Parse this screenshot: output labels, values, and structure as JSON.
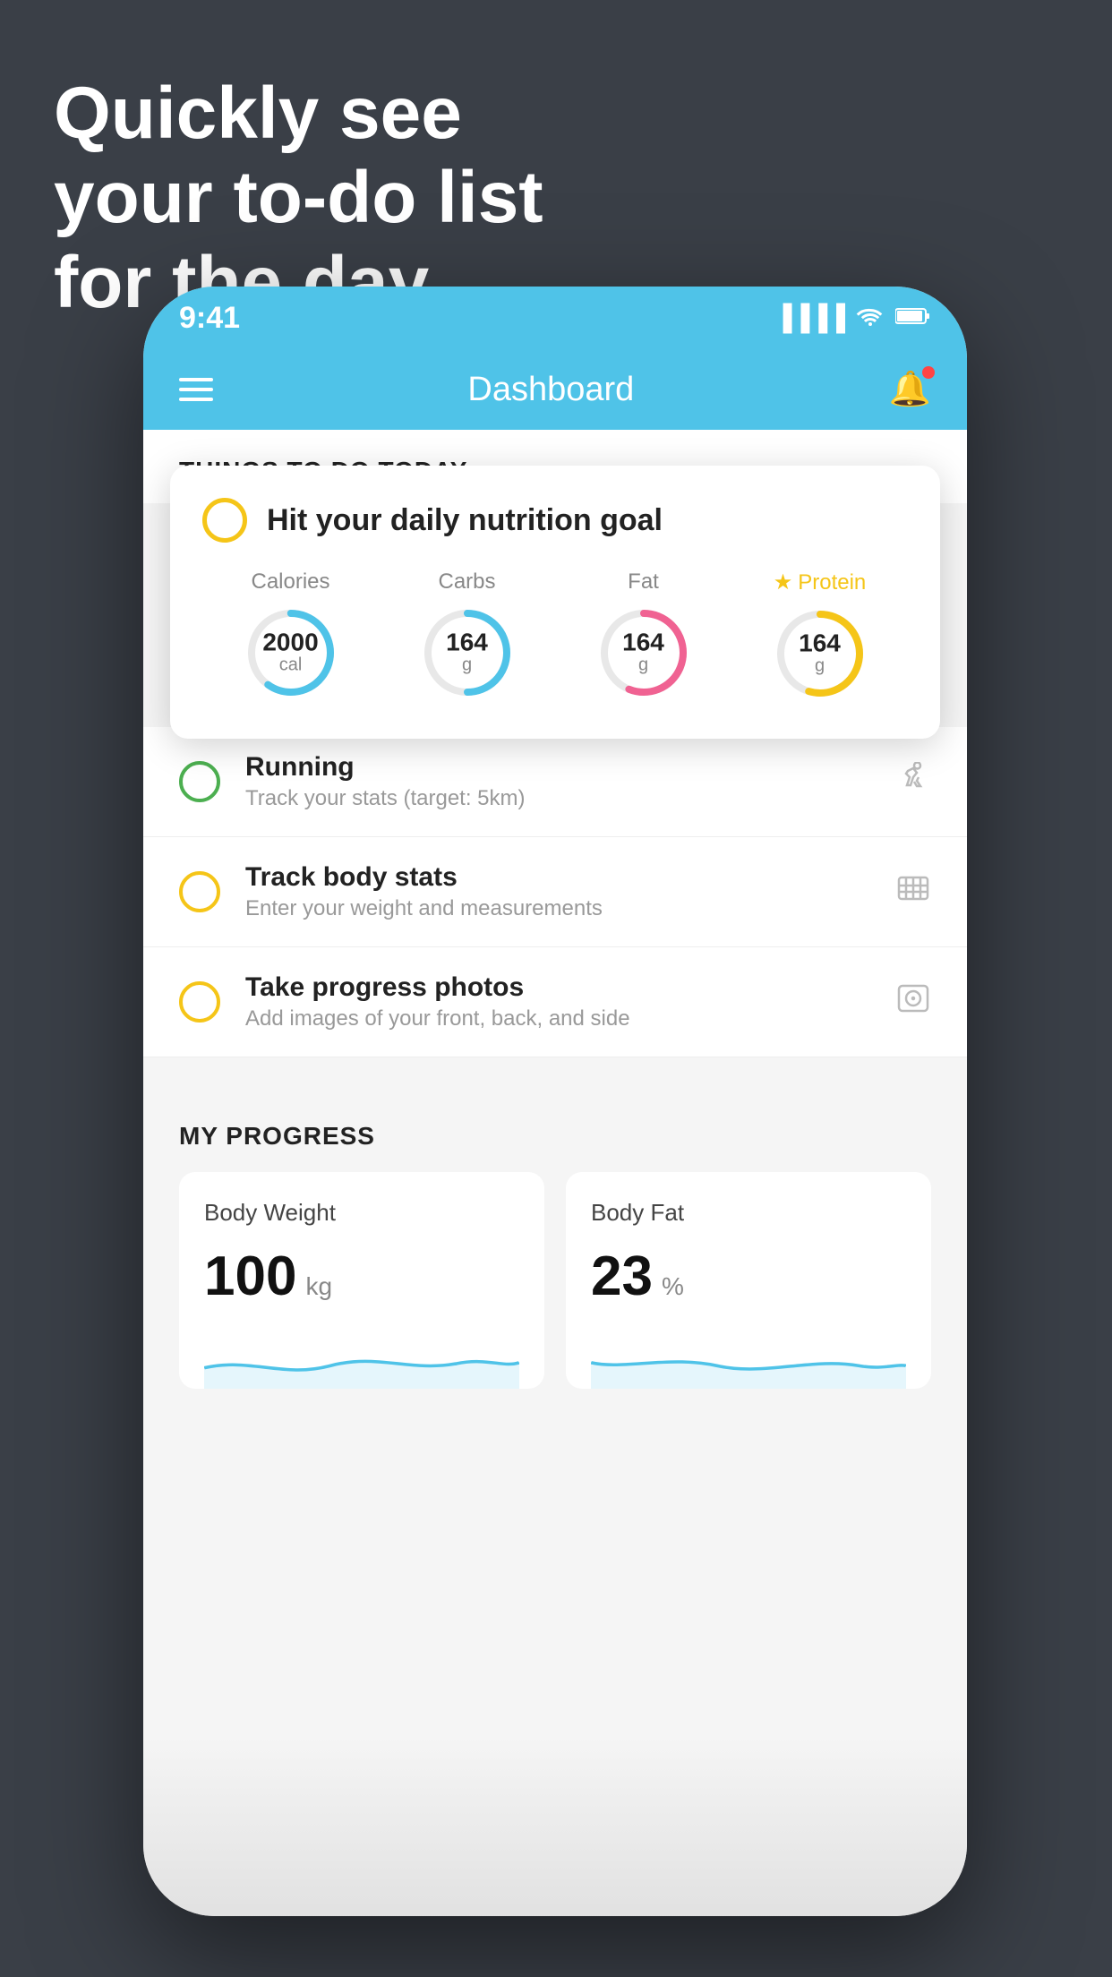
{
  "headline": {
    "line1": "Quickly see",
    "line2": "your to-do list",
    "line3": "for the day."
  },
  "statusBar": {
    "time": "9:41",
    "signal": "▐▐▐▐",
    "wifi": "wifi",
    "battery": "battery"
  },
  "navBar": {
    "title": "Dashboard"
  },
  "thingsToDo": {
    "sectionTitle": "THINGS TO DO TODAY"
  },
  "nutritionCard": {
    "title": "Hit your daily nutrition goal",
    "macros": [
      {
        "label": "Calories",
        "value": "2000",
        "unit": "cal",
        "color": "#4fc3e8",
        "progress": 0.6
      },
      {
        "label": "Carbs",
        "value": "164",
        "unit": "g",
        "color": "#4fc3e8",
        "progress": 0.5
      },
      {
        "label": "Fat",
        "value": "164",
        "unit": "g",
        "color": "#f06292",
        "progress": 0.7
      },
      {
        "label": "Protein",
        "value": "164",
        "unit": "g",
        "color": "#f5c518",
        "progress": 0.55,
        "star": true
      }
    ]
  },
  "todoItems": [
    {
      "name": "Running",
      "desc": "Track your stats (target: 5km)",
      "circleColor": "green",
      "icon": "👟"
    },
    {
      "name": "Track body stats",
      "desc": "Enter your weight and measurements",
      "circleColor": "yellow",
      "icon": "⊡"
    },
    {
      "name": "Take progress photos",
      "desc": "Add images of your front, back, and side",
      "circleColor": "yellow",
      "icon": "👤"
    }
  ],
  "progress": {
    "sectionTitle": "MY PROGRESS",
    "cards": [
      {
        "title": "Body Weight",
        "value": "100",
        "unit": "kg"
      },
      {
        "title": "Body Fat",
        "value": "23",
        "unit": "%"
      }
    ]
  }
}
